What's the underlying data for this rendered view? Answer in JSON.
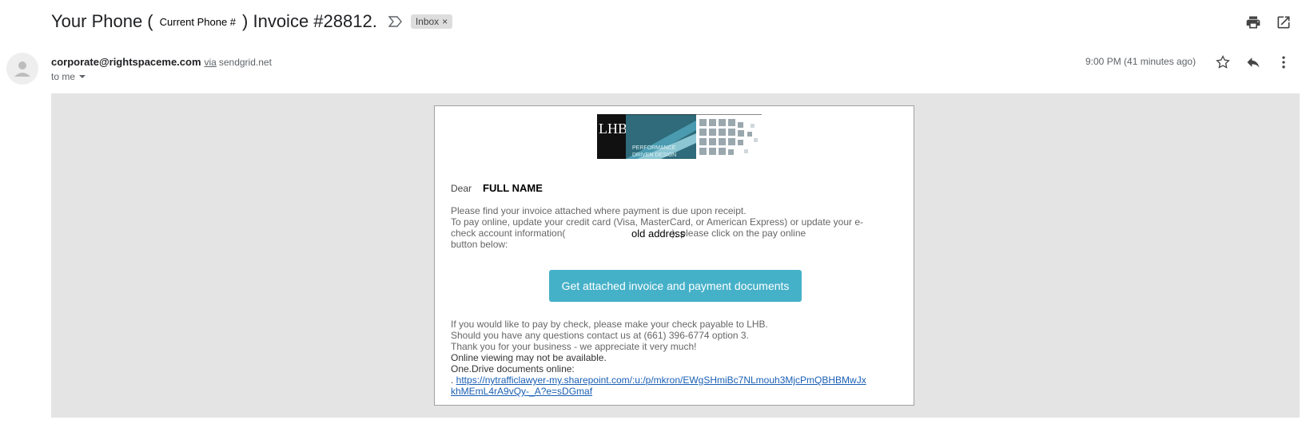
{
  "subject": {
    "prefix": "Your Phone (",
    "placeholder_phone": "Current Phone #",
    "suffix": ") Invoice #28812.",
    "label": "Inbox",
    "label_close": "×"
  },
  "header_actions": {
    "print_icon": "print-icon",
    "popout_icon": "open-in-new-window-icon"
  },
  "message": {
    "sender_email": "corporate@rightspaceme.com",
    "via_label": "via",
    "via_host": "sendgrid.net",
    "recipient": "to me",
    "time": "9:00 PM (41 minutes ago)",
    "row_icons": [
      "star-icon",
      "reply-icon",
      "more-vert-icon"
    ]
  },
  "email_body": {
    "dear": "Dear",
    "full_name": "FULL NAME",
    "paragraph_lines": [
      "Please find your invoice attached where payment is due upon receipt.",
      "To pay online, update your credit card (Visa, MasterCard, or American Express) or update your e-",
      "check account information(                                        ), please click on the pay online",
      "button below:"
    ],
    "old_address": "old address",
    "button_label": "Get attached invoice and payment documents",
    "footer_lines": [
      "If you would like to pay by check, please make your check payable to LHB.",
      "Should you have any questions contact us at (661) 396-6774 option 3.",
      "Thank you for your business - we appreciate it very much!"
    ],
    "online_lines": [
      "Online viewing may not be available.",
      "One.Drive documents online:"
    ],
    "link_prefix": ". ",
    "link_line1": "https://nytrafficlawyer-my.sharepoint.com/:u:/p/mkron/EWgSHmiBc7NLmouh3MjcPmQBHBMwJx",
    "link_line2": "khMEmL4rA9vQy-_A?e=sDGmaf"
  },
  "logo": {
    "letters": "LHB",
    "tagline1": "PERFORMANCE",
    "tagline2": "DRIVEN DESIGN"
  },
  "colors": {
    "button": "#45b1c8",
    "content_bg": "#e4e4e4",
    "link": "#1a5fb4"
  }
}
